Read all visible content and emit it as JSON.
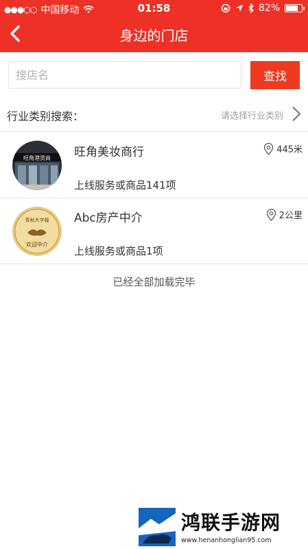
{
  "status_bar": {
    "carrier": "中国移动",
    "time": "01:58",
    "battery": "82%",
    "battery_level": 0.82
  },
  "header": {
    "title": "身边的门店",
    "back_icon": "chevron-left-icon"
  },
  "search": {
    "placeholder": "搜店名",
    "button_label": "查找"
  },
  "category": {
    "label": "行业类别搜索：",
    "select_placeholder": "请选择行业类别"
  },
  "stores": [
    {
      "name": "旺角美妆商行",
      "info": "上线服务或商品141项",
      "distance": "445米",
      "avatar_sign": "旺角港货商"
    },
    {
      "name": "Abc房产中介",
      "info": "上线服务或商品1项",
      "distance": "2公里",
      "avatar_top": "青秋大字報",
      "avatar_bottom": "欢迎中介"
    }
  ],
  "list_end": "已经全部加载完毕",
  "watermark": {
    "title": "鸿联手游网",
    "url": "www.henanhonglian95.com"
  },
  "colors": {
    "header": "#ed3127",
    "button": "#ee3a20"
  }
}
